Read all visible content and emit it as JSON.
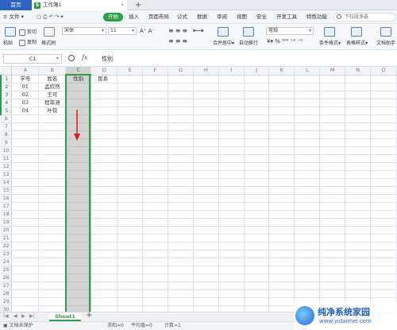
{
  "tabs": {
    "home": "首页",
    "doc": "工作簿1",
    "doc_icon": "S"
  },
  "menu": {
    "file": "文件",
    "items": [
      "开始",
      "插入",
      "页面布局",
      "公式",
      "数据",
      "审阅",
      "视图",
      "安全",
      "开发工具",
      "特色功能"
    ],
    "search_placeholder": "下拉段多选"
  },
  "ribbon": {
    "cut": "剪切",
    "copy": "复制",
    "paste": "粘贴",
    "format_painter": "格式刷",
    "font_name": "宋体",
    "font_size": "11",
    "merge": "合并居中",
    "wrap": "自动换行",
    "number_format": "常规",
    "cond_format": "条件格式",
    "table_style": "表格样式",
    "doc_helper": "文档助手"
  },
  "formula_bar": {
    "cell_ref": "C1",
    "fx": "fx",
    "value": "性别"
  },
  "sheet": {
    "columns": [
      "A",
      "B",
      "C",
      "D",
      "E",
      "F",
      "G",
      "H",
      "I",
      "J",
      "K",
      "L",
      "M",
      "N",
      "O"
    ],
    "selected_column": "C",
    "rows": [
      [
        "学号",
        "姓名",
        "性别",
        "民系"
      ],
      [
        "01",
        "孟欣然",
        "",
        ""
      ],
      [
        "02",
        "王可",
        "",
        ""
      ],
      [
        "03",
        "程菲涵",
        "",
        ""
      ],
      [
        "04",
        "叶钦",
        "",
        ""
      ]
    ],
    "total_rows": 30
  },
  "sheet_tabs": {
    "active": "Sheet1"
  },
  "status": {
    "protect": "文档未保护",
    "sum": "求和=0",
    "avg": "平均值=0",
    "count": "计数=1"
  },
  "watermark": {
    "title": "纯净系统家园",
    "url": "www.yidaimei.com"
  },
  "colors": {
    "accent": "#2aa147",
    "home_tab": "#2b64c3"
  }
}
